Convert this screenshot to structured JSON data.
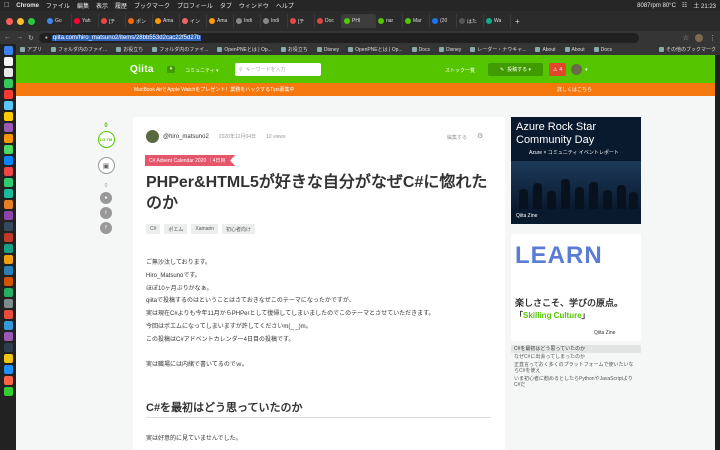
{
  "menubar": {
    "app": "Chrome",
    "items": [
      "ファイル",
      "編集",
      "表示",
      "履歴",
      "ブックマーク",
      "プロフィール",
      "タブ",
      "ウィンドウ",
      "ヘルプ"
    ],
    "status": "8087rpm 80°C",
    "clock": "土 21:23"
  },
  "tabs": [
    {
      "label": "Go",
      "color": "#4285f4"
    },
    {
      "label": "Yah",
      "color": "#ff0033"
    },
    {
      "label": "[チ",
      "color": "#e44"
    },
    {
      "label": "ポン",
      "color": "#f60"
    },
    {
      "label": "Ama",
      "color": "#f90"
    },
    {
      "label": "イン",
      "color": "#e66"
    },
    {
      "label": "Ama",
      "color": "#f90"
    },
    {
      "label": "Indi",
      "color": "#888"
    },
    {
      "label": "Indi",
      "color": "#888"
    },
    {
      "label": "[チ",
      "color": "#e44"
    },
    {
      "label": "Doc",
      "color": "#d44"
    },
    {
      "label": "PHI",
      "color": "#55c500",
      "active": true
    },
    {
      "label": "nar",
      "color": "#55c500"
    },
    {
      "label": "Mar",
      "color": "#55c500"
    },
    {
      "label": "(20",
      "color": "#1877f2"
    },
    {
      "label": "はた",
      "color": "#555"
    },
    {
      "label": "Wa",
      "color": "#1a8"
    }
  ],
  "address": {
    "url": "qiita.com/hiro_matsuno2/items/28bb553d2cac22f5d27b"
  },
  "bookmarks": [
    {
      "label": "アプリ"
    },
    {
      "label": "フォルダ内のファイ..."
    },
    {
      "label": "お役立ち"
    },
    {
      "label": "フォルダ内のファイ..."
    },
    {
      "label": "OpenPNEとは | Op..."
    },
    {
      "label": "お役立ち"
    },
    {
      "label": "Disney"
    },
    {
      "label": "OpenPNEとは | Op..."
    },
    {
      "label": "Docs"
    },
    {
      "label": "Disney"
    },
    {
      "label": "レーダー・ナウキャ..."
    },
    {
      "label": "About"
    },
    {
      "label": "About"
    },
    {
      "label": "Docs"
    }
  ],
  "bookmarks_other": "その他のブックマーク",
  "qiita": {
    "logo": "Qiita",
    "community": "コミュニティ ▾",
    "search_placeholder": "キーワードを入力",
    "stock": "ストック一覧",
    "post": "投稿する ▾",
    "notifications": "4",
    "banner_text": "MacBook AirとApple Watchをプレゼント！業務をハックするTips募集中",
    "banner_link": "詳しくはこちら"
  },
  "side": {
    "likes": "0",
    "lgtm": "LG TM",
    "comments": "0"
  },
  "article": {
    "author": "@hiro_matsuno2",
    "date": "2020年12月04日",
    "views": "12 views",
    "edit": "編集する",
    "ribbon": "C# Advent Calendar 2020 ｜4日目",
    "title": "PHPer&HTML5が好きな自分がなぜC#に惚れたのか",
    "tags": [
      "C#",
      "ポエム",
      "Xamarin",
      "初心者向け"
    ],
    "paragraphs": [
      "ご無沙汰しております。",
      "Hiro_Matsunoです。",
      "ほぼ10ヶ月ぶりかなぁ。",
      "qiitaで投稿するのはということはさておきなぜこのテーマになったかですが、",
      "実は現在C#よりも今年11月からPHPerとして復帰してしまいましたのでこのテーマとさせていただきます。",
      "今回はポエムになってしまいますが許してくださいm(_ _)m。",
      "この投稿はC#アドベントカレンダー4日目の投稿です。",
      "",
      "実は職場には内緒で書いてるのでｗ。"
    ],
    "h2": "C#を最初はどう思っていたのか",
    "after": "実は好意的に見ていませんでした。"
  },
  "ads": {
    "ad1_title": "Azure Rock Star Community Day",
    "ad1_sub": "Azure × コミュニティ イベントレポート",
    "ad1_foot": "Qiita Zine",
    "ad2_big": "LEARN",
    "ad2_line1": "楽しさこそ、学びの原点。",
    "ad2_line2_pre": "「",
    "ad2_line2_em": "Skilling Culture",
    "ad2_line2_post": "」",
    "ad2_foot": "Qiita Zine"
  },
  "toc": [
    "C#を最初はどう思っていたのか",
    "なぜC#に出会ってしまったのか",
    "正直言っておく多くのプラットフォームで使いたいならC#を使え",
    "いま初心者に勧めるとしたらPythonやJavaScriptよりC#だ"
  ]
}
